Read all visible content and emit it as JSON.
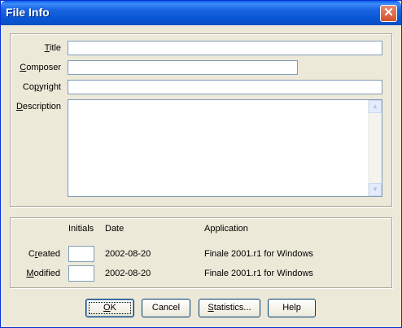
{
  "window": {
    "title": "File Info",
    "close_glyph": "✕"
  },
  "fields": {
    "title": {
      "label_pre": "",
      "label_u": "T",
      "label_post": "itle",
      "value": ""
    },
    "composer": {
      "label_pre": "",
      "label_u": "C",
      "label_post": "omposer",
      "value": ""
    },
    "copyright": {
      "label_pre": "Co",
      "label_u": "p",
      "label_post": "yright",
      "value": ""
    },
    "description": {
      "label_pre": "",
      "label_u": "D",
      "label_post": "escription",
      "value": ""
    }
  },
  "history": {
    "headers": {
      "initials": "Initials",
      "date": "Date",
      "application": "Application"
    },
    "rows": [
      {
        "label_pre": "C",
        "label_u": "r",
        "label_post": "eated",
        "initials": "",
        "date": "2002-08-20",
        "application": "Finale 2001.r1 for Windows"
      },
      {
        "label_pre": "",
        "label_u": "M",
        "label_post": "odified",
        "initials": "",
        "date": "2002-08-20",
        "application": "Finale 2001.r1 for Windows"
      }
    ]
  },
  "buttons": {
    "ok": {
      "pre": "",
      "u": "O",
      "post": "K"
    },
    "cancel": {
      "pre": "Cancel",
      "u": "",
      "post": ""
    },
    "stats": {
      "pre": "",
      "u": "S",
      "post": "tatistics..."
    },
    "help": {
      "pre": "Help",
      "u": "",
      "post": ""
    }
  },
  "icons": {
    "close": "close-icon",
    "scroll_up": "scroll-up-arrow-icon",
    "scroll_down": "scroll-down-arrow-icon"
  },
  "colors": {
    "titlebar": "#0758d6",
    "face": "#ece9d8",
    "input_border": "#7f9db9",
    "close": "#d4502d"
  }
}
